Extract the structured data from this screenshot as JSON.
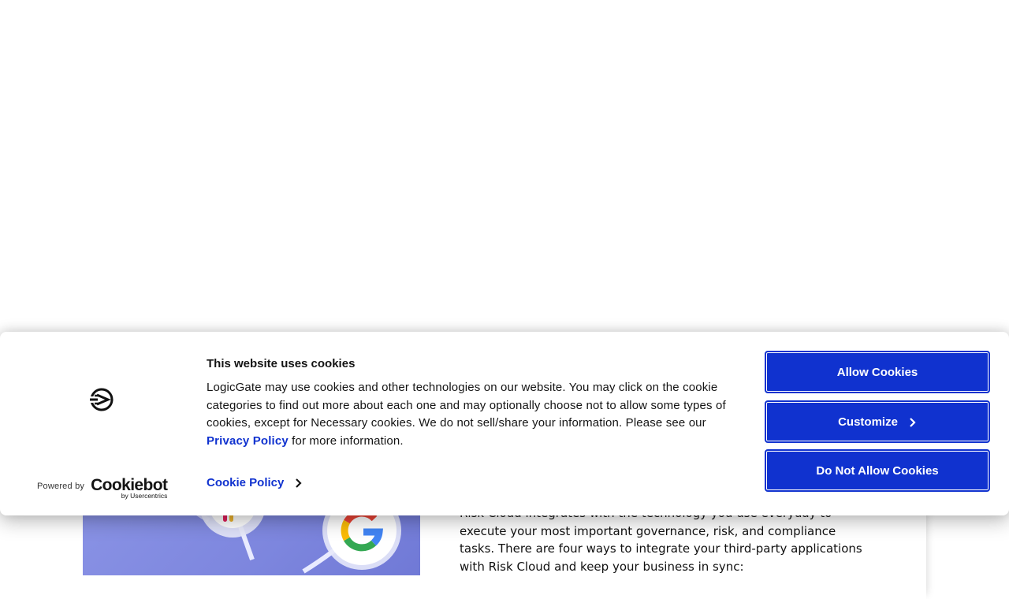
{
  "page": {
    "body_text": "Risk Cloud integrates with the technology you use everyday to execute your most important governance, risk, and compliance tasks. There are four ways to integrate your third-party applications with Risk Cloud and keep your business in sync:"
  },
  "cookie_banner": {
    "title": "This website uses cookies",
    "description_part1": "LogicGate may use cookies and other technologies on our website. You may click on the cookie categories to find out more about each one and may optionally choose not to allow some types of cookies, except for Necessary cookies.  We do not sell/share your information. Please see our ",
    "privacy_link": "Privacy Policy",
    "description_part2": " for more information.",
    "cookie_policy_link": "Cookie Policy",
    "powered_by": "Powered by",
    "cookiebot_logo": "Cookiebot",
    "cookiebot_sub": "by Usercentrics",
    "buttons": {
      "allow": "Allow Cookies",
      "customize": "Customize",
      "deny": "Do Not Allow Cookies"
    },
    "accent_color": "#1032cf"
  },
  "icons": {
    "brand_logo": "logicgate-logo-icon",
    "chevron": "chevron-right-icon"
  }
}
